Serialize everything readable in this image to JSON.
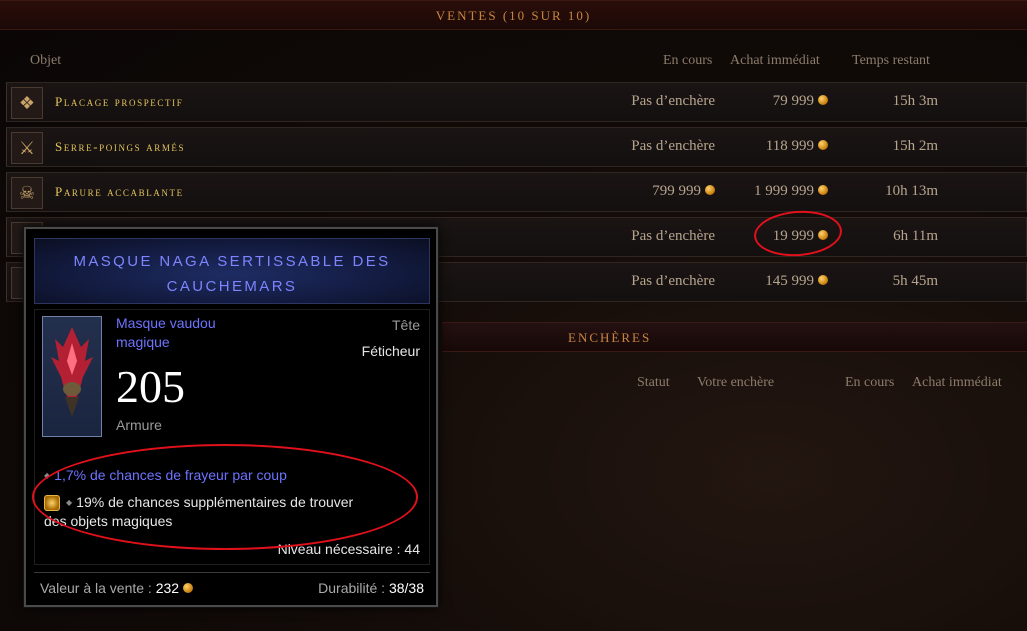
{
  "sales": {
    "title": "VENTES (10 SUR 10)",
    "columns": {
      "item": "Objet",
      "current": "En cours",
      "buyout": "Achat immédiat",
      "time": "Temps restant"
    },
    "rows": [
      {
        "name": "Placage prospectif",
        "current": "Pas d’enchère",
        "buyout": "79 999",
        "time": "15h 3m",
        "icon": "armor-icon"
      },
      {
        "name": "Serre-poings armés",
        "current": "Pas d’enchère",
        "buyout": "118 999",
        "time": "15h 2m",
        "icon": "fist-weapon-icon"
      },
      {
        "name": "Parure accablante",
        "current": "799 999",
        "buyout": "1 999 999",
        "time": "10h 13m",
        "icon": "amulet-icon"
      },
      {
        "name": "",
        "current": "Pas d’enchère",
        "buyout": "19 999",
        "time": "6h 11m",
        "icon": "mask-icon"
      },
      {
        "name": "",
        "current": "Pas d’enchère",
        "buyout": "145 999",
        "time": "5h 45m",
        "icon": "item-icon"
      }
    ]
  },
  "auctions": {
    "title": "ENCHÈRES",
    "columns": {
      "status": "Statut",
      "your_bid": "Votre enchère",
      "current": "En cours",
      "buyout": "Achat immédiat"
    }
  },
  "tooltip": {
    "title_line1": "MASQUE NAGA SERTISSABLE DES",
    "title_line2": "CAUCHEMARS",
    "type_line1": "Masque vaudou",
    "type_line2": "magique",
    "slot": "Tête",
    "class": "Féticheur",
    "armor": "205",
    "armor_label": "Armure",
    "affix1": "1,7% de chances de frayeur par coup",
    "affix2_line1": "19% de chances supplémentaires de trouver",
    "affix2_line2": "des objets magiques",
    "level": "Niveau nécessaire : 44",
    "sell_label": "Valeur à la vente :",
    "sell_value": "232",
    "durability_label": "Durabilité :",
    "durability_value": "38/38"
  },
  "colors": {
    "annotation": "#e0111b",
    "magic_blue": "#6e73ff",
    "item_gold": "#e2c35c"
  }
}
